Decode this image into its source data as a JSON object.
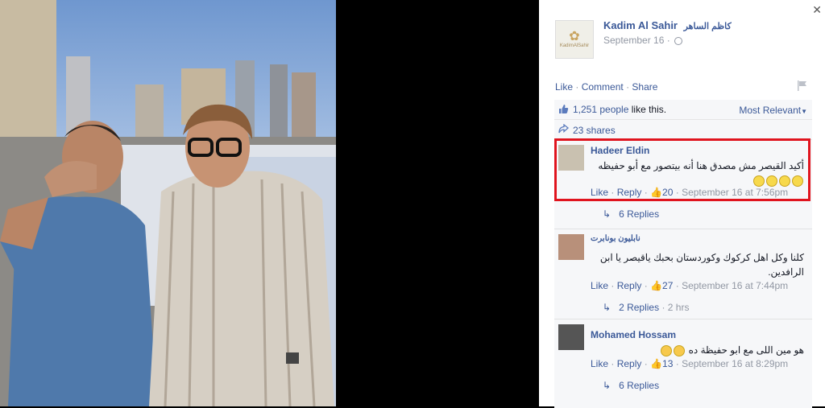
{
  "post": {
    "page_name": "Kadim Al Sahir",
    "page_name_ar": "كاظم الساهر",
    "avatar_caption": "KadimAlSahir",
    "date": "September 16 ·",
    "actions": [
      "Like",
      "Comment",
      "Share"
    ],
    "likes_count": "1,251 people",
    "likes_suffix": " like this.",
    "sort_label": "Most Relevant",
    "shares": "23 shares"
  },
  "comments": [
    {
      "name": "Hadeer Eldin",
      "text": "أكيد القيصر مش مصدق هنا أنه بيتصور مع أبو حفيظه",
      "emoji_count": 4,
      "like": "Like",
      "reply": "Reply",
      "likes": "20",
      "time": "September 16 at 7:56pm",
      "replies": "6 Replies",
      "replies_extra": "",
      "highlighted": true
    },
    {
      "name": "نابليون بونابرت",
      "text": "كلنا وكل اهل كركوك وكوردستان بحبك ياقيصر يا ابن الرافدين.",
      "emoji_count": 0,
      "like": "Like",
      "reply": "Reply",
      "likes": "27",
      "time": "September 16 at 7:44pm",
      "replies": "2 Replies",
      "replies_extra": "2 hrs",
      "highlighted": false
    },
    {
      "name": "Mohamed Hossam",
      "text": "هو مين اللى مع ابو حفيظة ده",
      "emoji_count": 2,
      "like": "Like",
      "reply": "Reply",
      "likes": "13",
      "time": "September 16 at 8:29pm",
      "replies": "6 Replies",
      "replies_extra": "",
      "highlighted": false
    }
  ],
  "colors": {
    "link": "#3b5998",
    "meta_grey": "#9197a3",
    "highlight_border": "#e0141e"
  }
}
